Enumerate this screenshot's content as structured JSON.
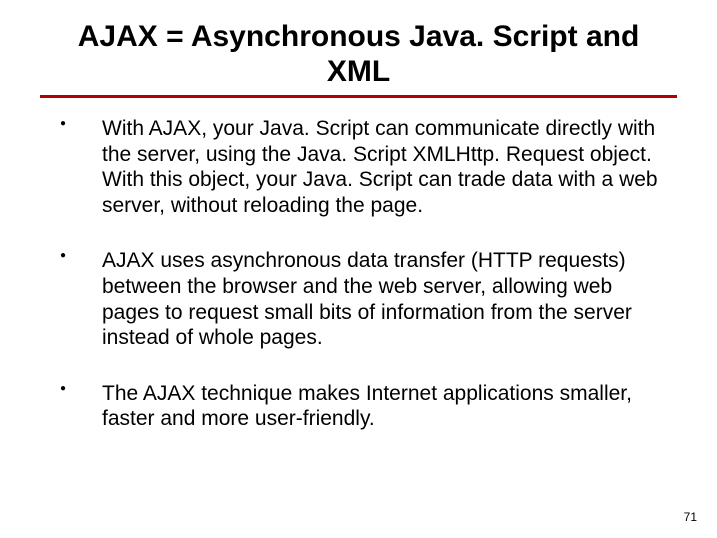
{
  "title": "AJAX = Asynchronous Java. Script and XML",
  "bullets": [
    "With AJAX, your Java. Script can communicate directly with the server, using the Java. Script XMLHttp. Request object. With this object, your Java. Script can trade data with a web server, without reloading the page.",
    "AJAX uses asynchronous data transfer (HTTP requests) between the browser and the web server, allowing web pages to request small bits of information from the server instead of whole pages.",
    "The AJAX technique makes Internet applications smaller, faster and more user-friendly."
  ],
  "page_number": "71"
}
